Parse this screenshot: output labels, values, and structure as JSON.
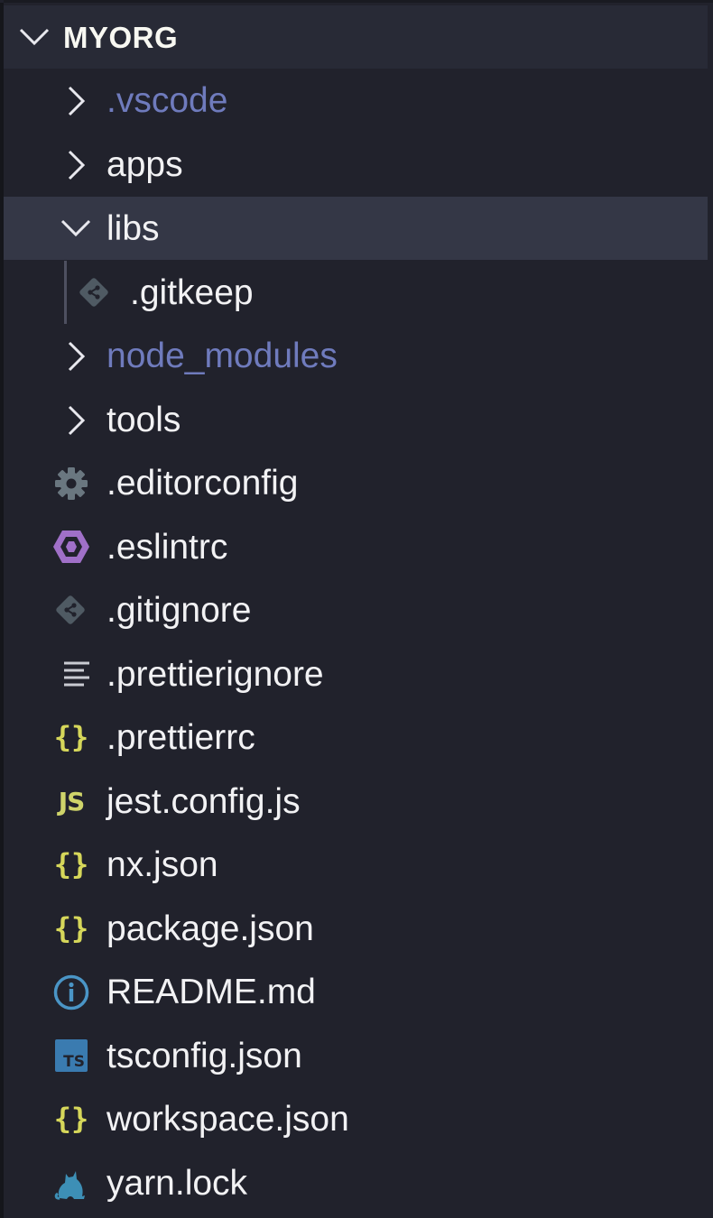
{
  "explorer": {
    "root_label": "MYORG",
    "items": [
      {
        "label": ".vscode",
        "type": "folder",
        "state": "collapsed",
        "icon": "chevron-right-icon",
        "muted": true
      },
      {
        "label": "apps",
        "type": "folder",
        "state": "collapsed",
        "icon": "chevron-right-icon"
      },
      {
        "label": "libs",
        "type": "folder",
        "state": "expanded",
        "icon": "chevron-down-icon",
        "selected": true
      },
      {
        "label": ".gitkeep",
        "type": "file",
        "icon": "git-icon",
        "nested": true
      },
      {
        "label": "node_modules",
        "type": "folder",
        "state": "collapsed",
        "icon": "chevron-right-icon",
        "muted": true
      },
      {
        "label": "tools",
        "type": "folder",
        "state": "collapsed",
        "icon": "chevron-right-icon"
      },
      {
        "label": ".editorconfig",
        "type": "file",
        "icon": "gear-icon"
      },
      {
        "label": ".eslintrc",
        "type": "file",
        "icon": "eslint-hexagon-icon"
      },
      {
        "label": ".gitignore",
        "type": "file",
        "icon": "git-icon"
      },
      {
        "label": ".prettierignore",
        "type": "file",
        "icon": "lines-icon"
      },
      {
        "label": ".prettierrc",
        "type": "file",
        "icon": "braces-icon"
      },
      {
        "label": "jest.config.js",
        "type": "file",
        "icon": "js-icon",
        "icon_text": "JS"
      },
      {
        "label": "nx.json",
        "type": "file",
        "icon": "braces-icon"
      },
      {
        "label": "package.json",
        "type": "file",
        "icon": "braces-icon"
      },
      {
        "label": "README.md",
        "type": "file",
        "icon": "info-icon"
      },
      {
        "label": "tsconfig.json",
        "type": "file",
        "icon": "ts-icon",
        "icon_text": "TS"
      },
      {
        "label": "workspace.json",
        "type": "file",
        "icon": "braces-icon"
      },
      {
        "label": "yarn.lock",
        "type": "file",
        "icon": "yarn-cat-icon"
      }
    ]
  },
  "colors": {
    "background": "#21222c",
    "header_bg": "#282a36",
    "selected_bg": "#343746",
    "text": "#f2f2f4",
    "muted_text": "#6f7bbd",
    "json_icon": "#d6d75a",
    "js_icon": "#cfd46a",
    "eslint_icon": "#a070c8",
    "ts_icon": "#3a7bb0",
    "info_icon": "#4a95c6",
    "yarn_icon": "#3d8fb6",
    "git_icon": "#4f5a63",
    "gear_icon": "#6a7780"
  }
}
